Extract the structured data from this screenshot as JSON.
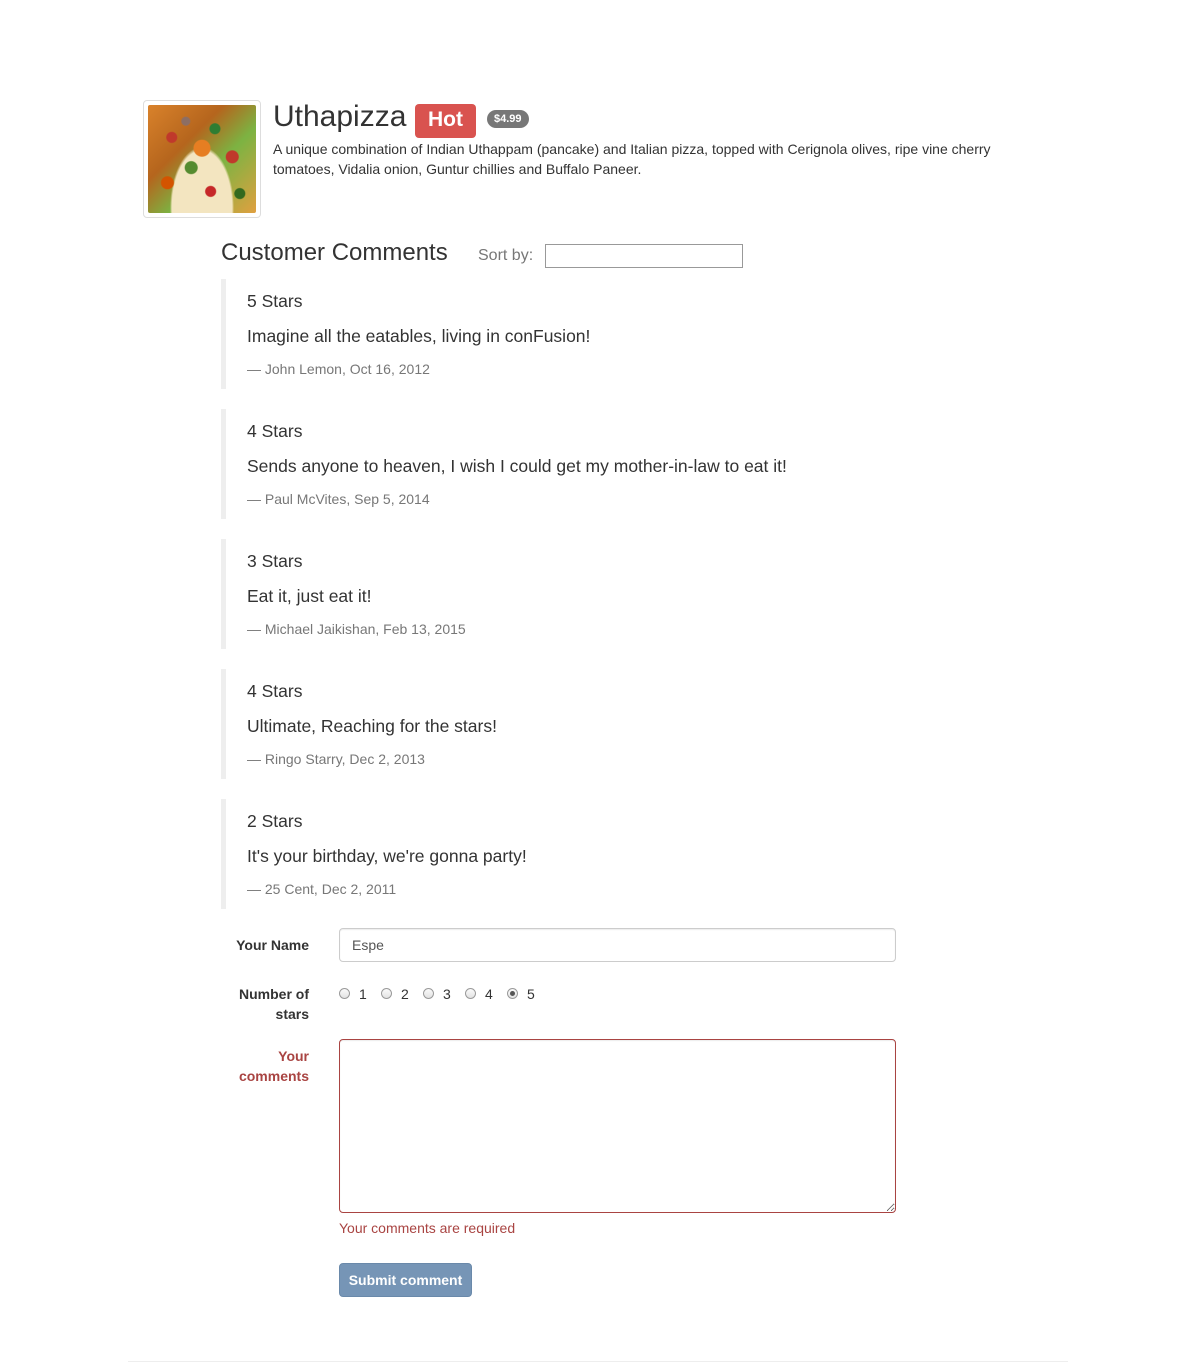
{
  "dish": {
    "name": "Uthapizza",
    "label": "Hot",
    "price": "$4.99",
    "description": "A unique combination of Indian Uthappam (pancake) and Italian pizza, topped with Cerignola olives, ripe vine cherry tomatoes, Vidalia onion, Guntur chillies and Buffalo Paneer.",
    "image_icon": "pizza-photo"
  },
  "comments_section": {
    "title": "Customer Comments",
    "sort_label": "Sort by:",
    "sort_value": ""
  },
  "comments": [
    {
      "rating": "5 Stars",
      "text": "Imagine all the eatables, living in conFusion!",
      "footer": "— John Lemon, Oct 16, 2012"
    },
    {
      "rating": "4 Stars",
      "text": "Sends anyone to heaven, I wish I could get my mother-in-law to eat it!",
      "footer": "— Paul McVites, Sep 5, 2014"
    },
    {
      "rating": "3 Stars",
      "text": "Eat it, just eat it!",
      "footer": "— Michael Jaikishan, Feb 13, 2015"
    },
    {
      "rating": "4 Stars",
      "text": "Ultimate, Reaching for the stars!",
      "footer": "— Ringo Starry, Dec 2, 2013"
    },
    {
      "rating": "2 Stars",
      "text": "It's your birthday, we're gonna party!",
      "footer": "— 25 Cent, Dec 2, 2011"
    }
  ],
  "form": {
    "name_label": "Your Name",
    "name_value": "Espe",
    "stars_label_line1": "Number of",
    "stars_label_line2": "stars",
    "star_options": [
      "1",
      "2",
      "3",
      "4",
      "5"
    ],
    "stars_selected": "5",
    "comments_label_line1": "Your",
    "comments_label_line2": "comments",
    "comments_value": "",
    "comments_error": "Your comments are required",
    "submit_label": "Submit comment"
  },
  "colors": {
    "hot_label": "#d9534f",
    "price_badge": "#777777",
    "error": "#a94442",
    "submit_button": "#7695b6"
  }
}
